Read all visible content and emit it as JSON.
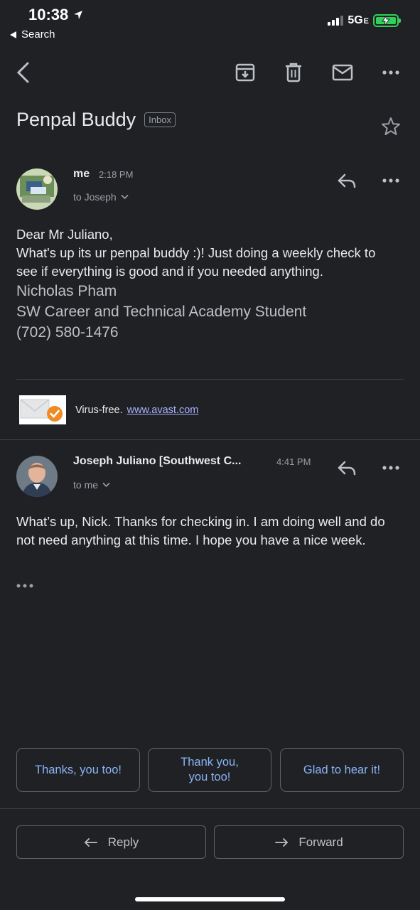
{
  "status": {
    "time": "10:38",
    "back_label": "Search",
    "network": "5G",
    "network_suffix": "E"
  },
  "subject": {
    "title": "Penpal Buddy",
    "label": "Inbox"
  },
  "message1": {
    "sender": "me",
    "time": "2:18 PM",
    "recipient": "to Joseph",
    "greeting": "Dear Mr Juliano,",
    "body": "What's up its ur penpal buddy :)! Just doing a weekly check to see if everything is good and if you needed anything.",
    "signature": [
      "Nicholas Pham",
      "SW Career and Technical Academy Student",
      "(702) 580-1476"
    ],
    "avast_text": "Virus-free.",
    "avast_link": "www.avast.com"
  },
  "message2": {
    "sender": "Joseph Juliano [Southwest C...",
    "time": "4:41 PM",
    "recipient": "to me",
    "body": "What’s up, Nick. Thanks for checking in. I am doing well and do not need anything at this time. I hope you have a nice week."
  },
  "smart_replies": [
    "Thanks, you too!",
    "Thank you, you too!",
    "Glad to hear it!"
  ],
  "actions": {
    "reply": "Reply",
    "forward": "Forward"
  },
  "colors": {
    "background": "#202124",
    "accent": "#8ab4f8",
    "link": "#a8b4ff"
  }
}
